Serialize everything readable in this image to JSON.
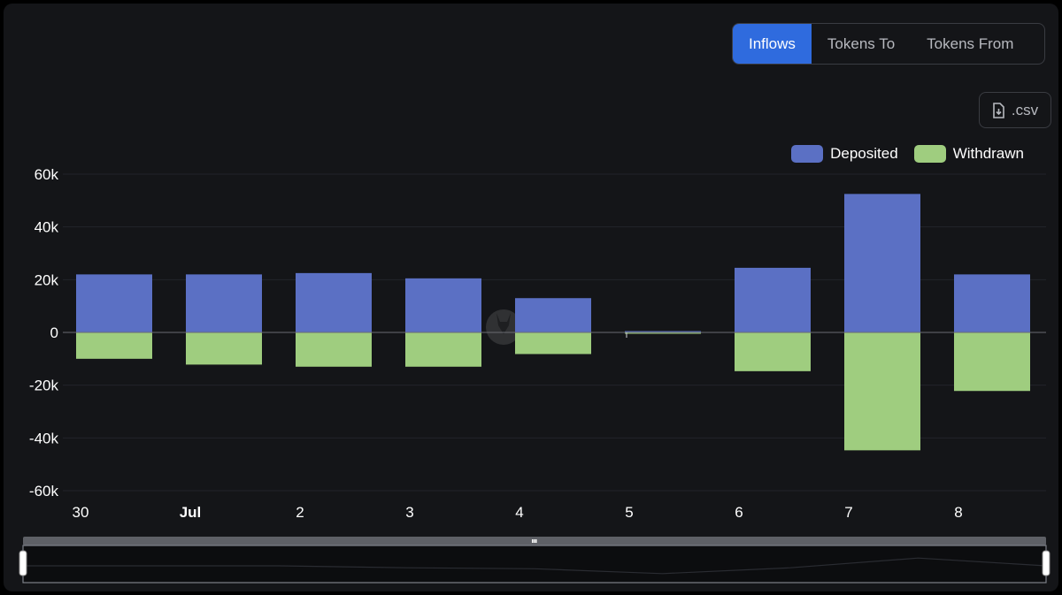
{
  "tabs": [
    {
      "label": "Inflows",
      "active": true
    },
    {
      "label": "Tokens To",
      "active": false
    },
    {
      "label": "Tokens From",
      "active": false
    }
  ],
  "csv_label": ".csv",
  "watermark": "ama",
  "colors": {
    "deposited": "#5b70c4",
    "withdrawn": "#9fcd7f",
    "accent": "#2f6bde"
  },
  "chart_data": {
    "type": "bar",
    "stacked": true,
    "categories": [
      "30",
      "Jul",
      "2",
      "3",
      "4",
      "5",
      "6",
      "7",
      "8"
    ],
    "category_bold": [
      false,
      true,
      false,
      false,
      false,
      false,
      false,
      false,
      false
    ],
    "series": [
      {
        "name": "Deposited",
        "values": [
          22000,
          22000,
          22500,
          20500,
          13000,
          500,
          24500,
          52500,
          22000
        ]
      },
      {
        "name": "Withdrawn",
        "values": [
          -10000,
          -12200,
          -13000,
          -13000,
          -8200,
          -300,
          -14700,
          -44700,
          -22200
        ]
      }
    ],
    "ylim": [
      -60000,
      60000
    ],
    "yticks": [
      {
        "value": 60000,
        "label": "60k"
      },
      {
        "value": 40000,
        "label": "40k"
      },
      {
        "value": 20000,
        "label": "20k"
      },
      {
        "value": 0,
        "label": "0"
      },
      {
        "value": -20000,
        "label": "-20k"
      },
      {
        "value": -40000,
        "label": "-40k"
      },
      {
        "value": -60000,
        "label": "-60k"
      }
    ],
    "legend_position": "top-right",
    "grid": true,
    "overview_series": [
      0.5,
      0.5,
      0.5,
      0.4,
      0.35,
      0.1,
      0.4,
      0.9,
      0.5
    ]
  }
}
